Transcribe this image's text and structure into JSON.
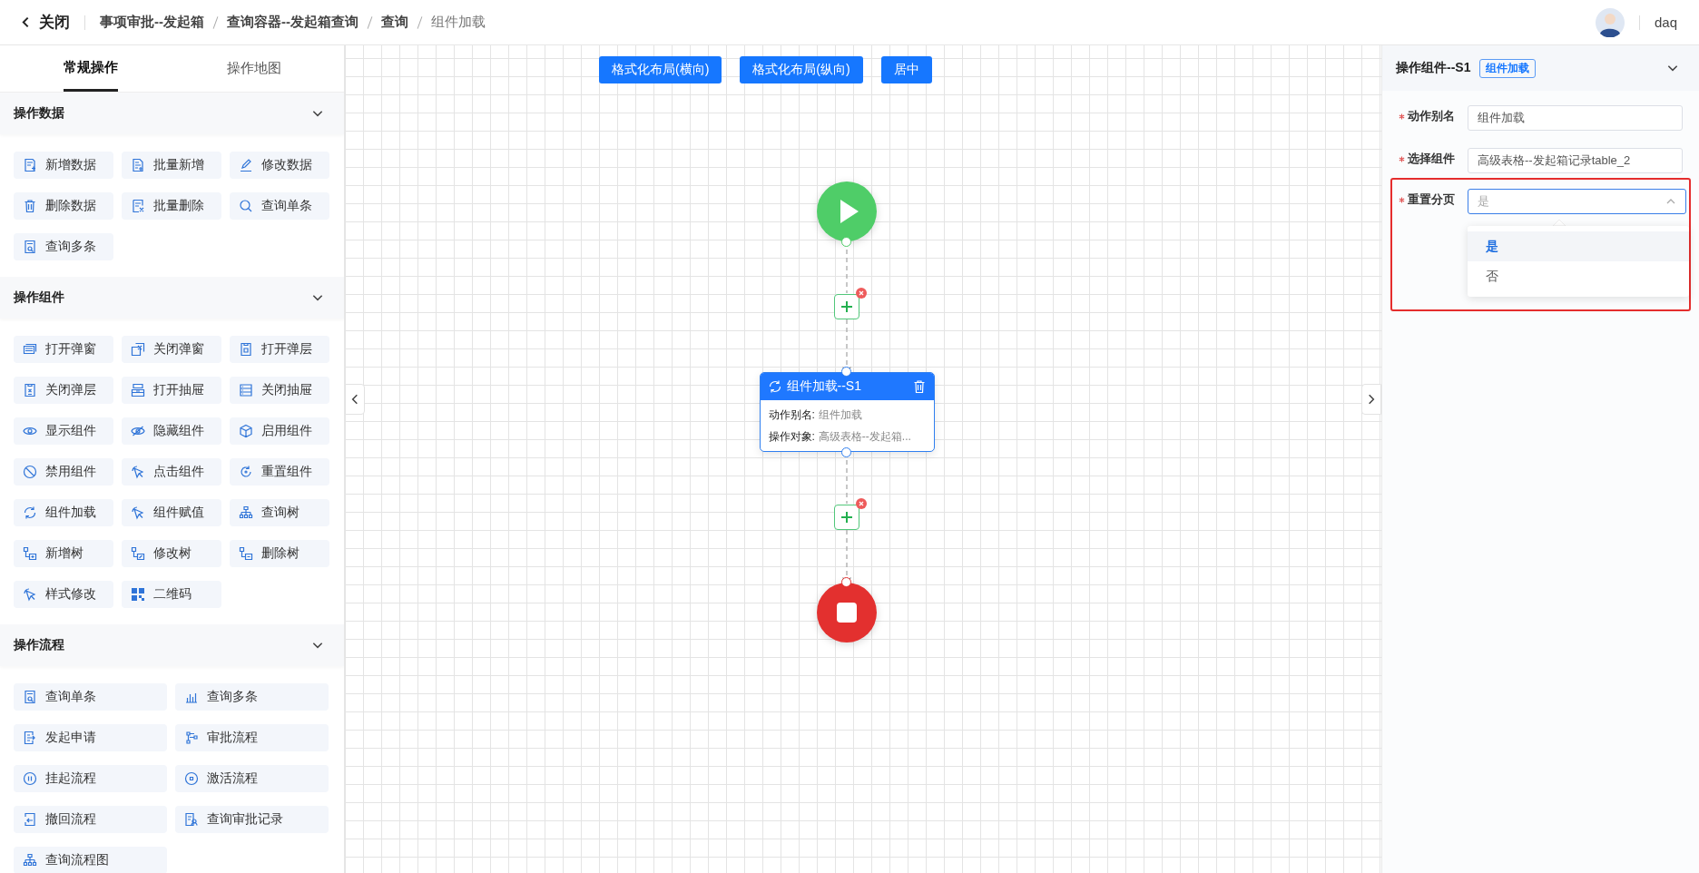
{
  "header": {
    "back_label": "关闭",
    "breadcrumb": [
      {
        "label": "事项审批--发起箱",
        "current": false
      },
      {
        "label": "查询容器--发起箱查询",
        "current": false
      },
      {
        "label": "查询",
        "current": false
      },
      {
        "label": "组件加载",
        "current": true
      }
    ],
    "user": {
      "name": "daq"
    }
  },
  "left_panel": {
    "tabs": [
      {
        "label": "常规操作",
        "selected": true
      },
      {
        "label": "操作地图",
        "selected": false
      }
    ],
    "sections": [
      {
        "title": "操作数据",
        "expanded": true,
        "items": [
          "新增数据",
          "批量新增",
          "修改数据",
          "删除数据",
          "批量删除",
          "查询单条",
          "查询多条"
        ]
      },
      {
        "title": "操作组件",
        "expanded": true,
        "items": [
          "打开弹窗",
          "关闭弹窗",
          "打开弹层",
          "关闭弹层",
          "打开抽屉",
          "关闭抽屉",
          "显示组件",
          "隐藏组件",
          "启用组件",
          "禁用组件",
          "点击组件",
          "重置组件",
          "组件加载",
          "组件赋值",
          "查询树",
          "新增树",
          "修改树",
          "删除树",
          "样式修改",
          "二维码"
        ]
      },
      {
        "title": "操作流程",
        "expanded": true,
        "items": [
          "查询单条",
          "查询多条",
          "发起申请",
          "审批流程",
          "挂起流程",
          "激活流程",
          "撤回流程",
          "查询审批记录",
          "查询流程图"
        ]
      }
    ]
  },
  "canvas": {
    "toolbar": [
      "格式化布局(横向)",
      "格式化布局(纵向)",
      "居中"
    ],
    "flow": [
      {
        "kind": "start"
      },
      {
        "kind": "add"
      },
      {
        "kind": "action",
        "title": "组件加载--S1",
        "fields": [
          {
            "label": "动作别名:",
            "value": "组件加载"
          },
          {
            "label": "操作对象:",
            "value": "高级表格--发起箱..."
          }
        ]
      },
      {
        "kind": "add"
      },
      {
        "kind": "end"
      }
    ]
  },
  "right_panel": {
    "title": "操作组件--S1",
    "tag": "组件加载",
    "fields": [
      {
        "label": "动作别名",
        "required": true,
        "kind": "input",
        "value": "组件加载"
      },
      {
        "label": "选择组件",
        "required": true,
        "kind": "input",
        "value": "高级表格--发起箱记录table_2"
      },
      {
        "label": "重置分页",
        "required": true,
        "kind": "select",
        "placeholder": "是",
        "expanded": true,
        "highlighted": true,
        "options": [
          {
            "label": "是",
            "selected": true
          },
          {
            "label": "否",
            "selected": false
          }
        ]
      }
    ]
  }
}
